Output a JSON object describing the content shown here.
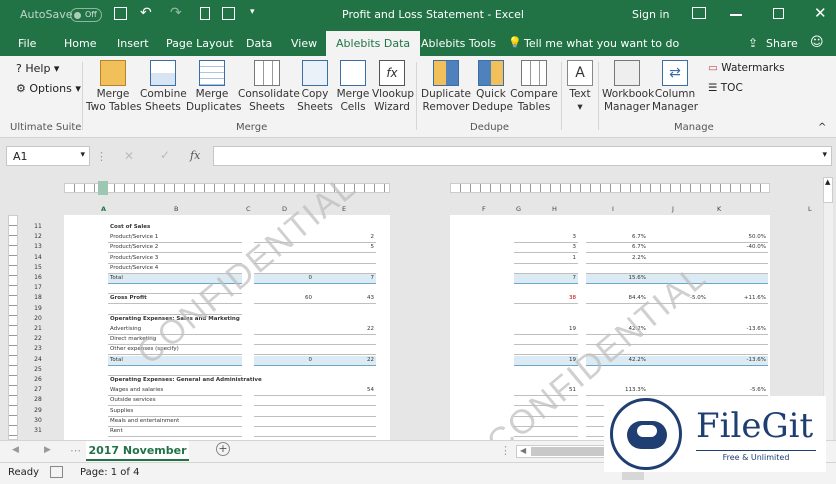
{
  "titlebar": {
    "autosave": "AutoSave",
    "autosave_state": "Off",
    "title": "Profit and Loss Statement  -  Excel",
    "signin": "Sign in"
  },
  "tabs": [
    "File",
    "Home",
    "Insert",
    "Page Layout",
    "Data",
    "View",
    "Ablebits Data",
    "Ablebits Tools"
  ],
  "tellme": "Tell me what you want to do",
  "share": "Share",
  "ribbon": {
    "help": "Help",
    "options": "Options",
    "group_ultimate": "Ultimate Suite",
    "merge_two": "Merge\nTwo Tables",
    "combine": "Combine\nSheets",
    "merge_dup": "Merge\nDuplicates",
    "consolidate": "Consolidate\nSheets",
    "copy": "Copy\nSheets",
    "merge_cells": "Merge\nCells",
    "vlookup": "Vlookup\nWizard",
    "group_merge": "Merge",
    "dup_remover": "Duplicate\nRemover",
    "quick_dedupe": "Quick\nDedupe",
    "compare": "Compare\nTables",
    "group_dedupe": "Dedupe",
    "text": "Text",
    "workbook": "Workbook\nManager",
    "column": "Column\nManager",
    "watermarks": "Watermarks",
    "toc": "TOC",
    "group_manage": "Manage"
  },
  "namebox": "A1",
  "fx": "fx",
  "sheet": {
    "watermark": "CONFIDENTIAL",
    "col_left": [
      "A",
      "B",
      "C",
      "D",
      "E"
    ],
    "col_right": [
      "F",
      "G",
      "H",
      "I",
      "J",
      "K"
    ],
    "rows": [
      {
        "n": "11",
        "label": "Cost of Sales",
        "bold": true
      },
      {
        "n": "12",
        "label": "Product/Service 1",
        "e": "2",
        "f": "3",
        "h": "6.7%",
        "j": "50.0%"
      },
      {
        "n": "13",
        "label": "Product/Service 2",
        "e": "5",
        "f": "3",
        "h": "6.7%",
        "j": "-40.0%"
      },
      {
        "n": "14",
        "label": "Product/Service 3",
        "f": "1",
        "h": "2.2%"
      },
      {
        "n": "15",
        "label": "Product/Service 4"
      },
      {
        "n": "16",
        "label": "Total",
        "d": "0",
        "e": "7",
        "f": "7",
        "h": "15.6%",
        "total": true
      },
      {
        "n": "17",
        "label": ""
      },
      {
        "n": "18",
        "label": "Gross Profit",
        "bold": true,
        "d": "60",
        "e": "43",
        "f": "38",
        "h": "84.4%",
        "i": "-5.0%",
        "j": "+11.6%"
      },
      {
        "n": "19",
        "label": ""
      },
      {
        "n": "20",
        "label": "Operating Expenses: Sales and Marketing",
        "bold": true
      },
      {
        "n": "21",
        "label": "Advertising",
        "e": "22",
        "f": "19",
        "h": "42.2%",
        "j": "-13.6%"
      },
      {
        "n": "22",
        "label": "Direct marketing"
      },
      {
        "n": "23",
        "label": "Other expenses (specify)"
      },
      {
        "n": "24",
        "label": "Total",
        "d": "0",
        "e": "22",
        "f": "19",
        "h": "42.2%",
        "j": "-13.6%",
        "total": true
      },
      {
        "n": "25",
        "label": ""
      },
      {
        "n": "26",
        "label": "Operating Expenses: General and Administrative",
        "bold": true
      },
      {
        "n": "27",
        "label": "Wages and salaries",
        "e": "54",
        "f": "51",
        "h": "113.3%",
        "j": "-5.6%"
      },
      {
        "n": "28",
        "label": "Outside services"
      },
      {
        "n": "29",
        "label": "Supplies"
      },
      {
        "n": "30",
        "label": "Meals and entertainment"
      },
      {
        "n": "31",
        "label": "Rent"
      }
    ]
  },
  "sheettab": "2017 November",
  "status": {
    "ready": "Ready",
    "page": "Page: 1 of 4"
  },
  "logo": {
    "name": "FileGit",
    "tagline": "Free & Unlimited"
  }
}
